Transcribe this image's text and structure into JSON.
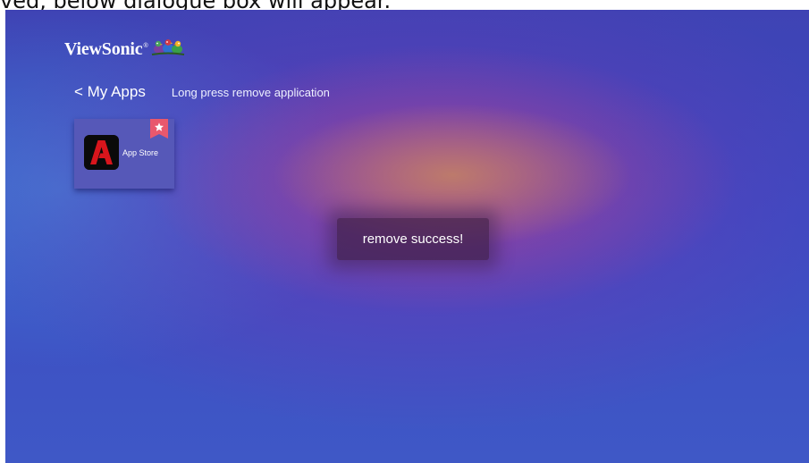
{
  "caption": {
    "text": "ved, below dialogue box will appear."
  },
  "header": {
    "brand": "ViewSonic",
    "brand_mark": "®"
  },
  "nav": {
    "back_label": "< My Apps",
    "hint": "Long press remove application"
  },
  "apps": [
    {
      "label": "App Store",
      "icon": "adobe-app-icon",
      "favorite": true
    }
  ],
  "toast": {
    "message": "remove success!"
  },
  "colors": {
    "background_top": "#3f43b4",
    "background_bottom": "#3f58c6",
    "glow_center": "#be7d69",
    "card": "#5658b8",
    "favorite_badge": "#e8586d",
    "app_icon_accent": "#d8151c",
    "toast_bg": "#3e2046"
  }
}
